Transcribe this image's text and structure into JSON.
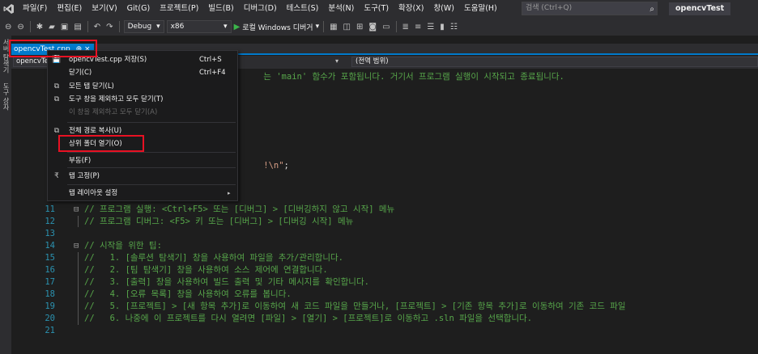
{
  "menubar": {
    "items": [
      "파일(F)",
      "편집(E)",
      "보기(V)",
      "Git(G)",
      "프로젝트(P)",
      "빌드(B)",
      "디버그(D)",
      "테스트(S)",
      "분석(N)",
      "도구(T)",
      "확장(X)",
      "창(W)",
      "도움말(H)"
    ],
    "search_placeholder": "검색 (Ctrl+Q)",
    "solution_name": "opencvTest"
  },
  "toolbar": {
    "config": "Debug",
    "platform": "x86",
    "run_label": "로컬 Windows 디버거"
  },
  "left_strip": {
    "tabs": [
      "서버 탐색기",
      "도구 상자"
    ]
  },
  "doc_tab": {
    "title": "opencvTest.cpp",
    "pin": "⊕",
    "close": "×"
  },
  "navbar": {
    "project": "opencvTest",
    "scope": "(전역 범위)"
  },
  "editor": {
    "lines": [
      {
        "num": "",
        "fold": "",
        "code": "",
        "tokens": [
          {
            "t": "cmt",
            "v": "                                   는 'main' 함수가 포함됩니다. 거기서 프로그램 실행이 시작되고 종료됩니다."
          }
        ]
      },
      {
        "num": "",
        "fold": "",
        "code": "",
        "tokens": []
      },
      {
        "num": "",
        "fold": "",
        "code": "",
        "tokens": []
      },
      {
        "num": "",
        "fold": "",
        "code": "",
        "tokens": []
      },
      {
        "num": "",
        "fold": "",
        "code": "",
        "tokens": []
      },
      {
        "num": "",
        "fold": "",
        "code": "",
        "tokens": []
      },
      {
        "num": "",
        "fold": "",
        "code": "",
        "tokens": []
      },
      {
        "num": "",
        "fold": "",
        "code": "",
        "tokens": [
          {
            "t": "str",
            "v": "                                   !\\n\""
          },
          {
            "t": "plain",
            "v": ";"
          }
        ]
      },
      {
        "num": "",
        "fold": "",
        "code": "",
        "tokens": []
      },
      {
        "num": "",
        "fold": "",
        "code": "",
        "tokens": []
      },
      {
        "num": "11",
        "fold": "⊟",
        "tokens": [
          {
            "t": "cmt",
            "v": "// 프로그램 실행: <Ctrl+F5> 또는 [디버그] > [디버깅하지 않고 시작] 메뉴"
          }
        ]
      },
      {
        "num": "12",
        "fold": "",
        "tokens": [
          {
            "t": "cmt",
            "v": "// 프로그램 디버그: <F5> 키 또는 [디버그] > [디버깅 시작] 메뉴"
          }
        ]
      },
      {
        "num": "13",
        "fold": "",
        "tokens": []
      },
      {
        "num": "14",
        "fold": "⊟",
        "tokens": [
          {
            "t": "cmt",
            "v": "// 시작을 위한 팁:"
          }
        ]
      },
      {
        "num": "15",
        "fold": "",
        "tokens": [
          {
            "t": "cmt",
            "v": "//   1. [솔루션 탐색기] 창을 사용하여 파일을 추가/관리합니다."
          }
        ]
      },
      {
        "num": "16",
        "fold": "",
        "tokens": [
          {
            "t": "cmt",
            "v": "//   2. [팀 탐색기] 창을 사용하여 소스 제어에 연결합니다."
          }
        ]
      },
      {
        "num": "17",
        "fold": "",
        "tokens": [
          {
            "t": "cmt",
            "v": "//   3. [출력] 창을 사용하여 빌드 출력 및 기타 메시지를 확인합니다."
          }
        ]
      },
      {
        "num": "18",
        "fold": "",
        "tokens": [
          {
            "t": "cmt",
            "v": "//   4. [오류 목록] 창을 사용하여 오류를 봅니다."
          }
        ]
      },
      {
        "num": "19",
        "fold": "",
        "tokens": [
          {
            "t": "cmt",
            "v": "//   5. [프로젝트] > [새 항목 추가]로 이동하여 새 코드 파일을 만들거나, [프로젝트] > [기존 항목 추가]로 이동하여 기존 코드 파일"
          }
        ]
      },
      {
        "num": "20",
        "fold": "",
        "tokens": [
          {
            "t": "cmt",
            "v": "//   6. 나중에 이 프로젝트를 다시 열려면 [파일] > [열기] > [프로젝트]로 이동하고 .sln 파일을 선택합니다."
          }
        ]
      },
      {
        "num": "21",
        "fold": "",
        "tokens": []
      }
    ]
  },
  "context_menu": {
    "items": [
      {
        "icon": "💾",
        "icon_name": "save-icon",
        "label": "opencvTest.cpp 저장(S)",
        "shortcut": "Ctrl+S",
        "disabled": false
      },
      {
        "icon": "",
        "icon_name": "",
        "label": "닫기(C)",
        "shortcut": "Ctrl+F4",
        "disabled": false
      },
      {
        "icon": "⧉",
        "icon_name": "close-all-icon",
        "label": "모든 탭 닫기(L)",
        "shortcut": "",
        "disabled": false
      },
      {
        "icon": "⧉",
        "icon_name": "close-others-icon",
        "label": "도구 창을 제외하고 모두 닫기(T)",
        "shortcut": "",
        "disabled": false
      },
      {
        "icon": "",
        "icon_name": "",
        "label": "이 창을 제외하고 모두 닫기(A)",
        "shortcut": "",
        "disabled": true
      },
      {
        "icon": "⧉",
        "icon_name": "copy-icon",
        "label": "전체 경로 복사(U)",
        "shortcut": "",
        "disabled": false
      },
      {
        "icon": "",
        "icon_name": "",
        "label": "상위 폴더 열기(O)",
        "shortcut": "",
        "disabled": false
      },
      {
        "icon": "",
        "icon_name": "",
        "label": "부동(F)",
        "shortcut": "",
        "disabled": false
      },
      {
        "icon": "₹",
        "icon_name": "pin-icon",
        "label": "탭 고정(P)",
        "shortcut": "",
        "disabled": false
      },
      {
        "icon": "",
        "icon_name": "",
        "label": "탭 레이아웃 설정",
        "shortcut": "",
        "disabled": false,
        "submenu": true
      }
    ]
  },
  "colors": {
    "accent": "#007acc",
    "highlight_box": "#e81123",
    "comment": "#57a64a",
    "line_number": "#2b91af"
  }
}
